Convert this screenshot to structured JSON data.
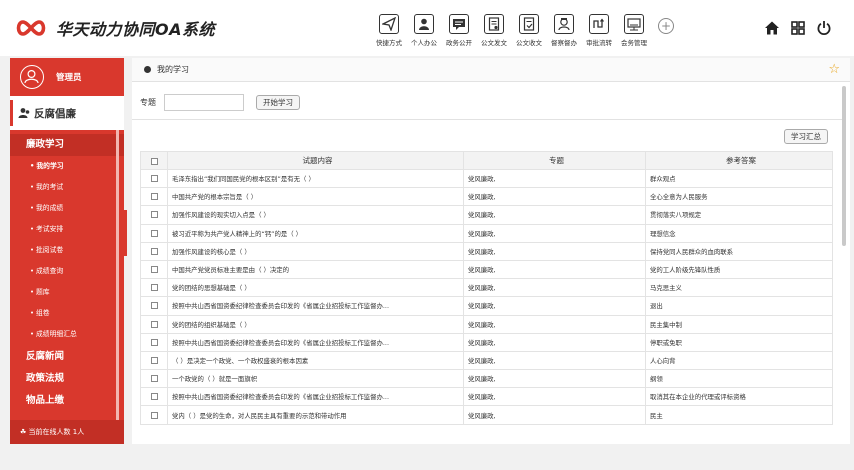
{
  "app": {
    "title": "华天动力协同OA系统",
    "brand_color": "#d9382d"
  },
  "toolbar": [
    {
      "label": "快捷方式",
      "icon": "send-icon"
    },
    {
      "label": "个人办公",
      "icon": "person-icon"
    },
    {
      "label": "政务公开",
      "icon": "chat-icon"
    },
    {
      "label": "公文发文",
      "icon": "document-icon"
    },
    {
      "label": "公文收文",
      "icon": "document-receive-icon"
    },
    {
      "label": "督察督办",
      "icon": "inspector-icon"
    },
    {
      "label": "审批流转",
      "icon": "flow-icon"
    },
    {
      "label": "会务管理",
      "icon": "meeting-icon"
    }
  ],
  "sidebar": {
    "user": "管理员",
    "section": "反腐倡廉",
    "groups": [
      {
        "label": "廉政学习",
        "active": true
      },
      {
        "label": "反腐新闻"
      },
      {
        "label": "政策法规"
      },
      {
        "label": "物品上缴"
      }
    ],
    "subitems": [
      {
        "label": "我的学习",
        "active": true
      },
      {
        "label": "我的考试"
      },
      {
        "label": "我的成绩"
      },
      {
        "label": "考试安排"
      },
      {
        "label": "批阅试卷"
      },
      {
        "label": "成绩查询"
      },
      {
        "label": "题库"
      },
      {
        "label": "组卷"
      },
      {
        "label": "成绩明细汇总"
      }
    ],
    "online": "当前在线人数 1人"
  },
  "main": {
    "breadcrumb": "我的学习",
    "filter_label": "专题",
    "filter_value": "",
    "start_button": "开始学习",
    "summary_button": "学习汇总",
    "columns": [
      "试题内容",
      "专题",
      "参考答案"
    ],
    "rows": [
      [
        "毛泽东指出“我们同国民党的根本区别”是有无（ ）",
        "党风廉政,",
        "群众观点"
      ],
      [
        "中国共产党的根本宗旨是（ ）",
        "党风廉政,",
        "全心全意为人民服务"
      ],
      [
        "加强作风建设的现实切入点是（ ）",
        "党风廉政,",
        "贯彻落实八项规定"
      ],
      [
        "被习近平称为共产党人精神上的“钙”的是（ ）",
        "党风廉政,",
        "理想信念"
      ],
      [
        "加强作风建设的核心是（ ）",
        "党风廉政,",
        "保持党同人民群众的血肉联系"
      ],
      [
        "中国共产党党员标准主要是由（ ）决定的",
        "党风廉政,",
        "党的工人阶级先锋队性质"
      ],
      [
        "党的团结的思想基础是（ ）",
        "党风廉政,",
        "马克思主义"
      ],
      [
        "按照中共山西省国资委纪律检查委员会印发的《省属企业招投标工作监督办...",
        "党风廉政,",
        "退出"
      ],
      [
        "党的团结的组织基础是（ ）",
        "党风廉政,",
        "民主集中制"
      ],
      [
        "按照中共山西省国资委纪律检查委员会印发的《省属企业招投标工作监督办...",
        "党风廉政,",
        "停职或免职"
      ],
      [
        "（ ）是决定一个政党、一个政权盛衰的根本因素",
        "党风廉政,",
        "人心向背"
      ],
      [
        "一个政党的（ ）就是一面旗帜",
        "党风廉政,",
        "纲领"
      ],
      [
        "按照中共山西省国资委纪律检查委员会印发的《省属企业招投标工作监督办...",
        "党风廉政,",
        "取消其在本企业的代理或评标资格"
      ],
      [
        "党内（ ）是党的生命，对人民民主具有重要的示范和带动作用",
        "党风廉政,",
        "民主"
      ]
    ]
  }
}
